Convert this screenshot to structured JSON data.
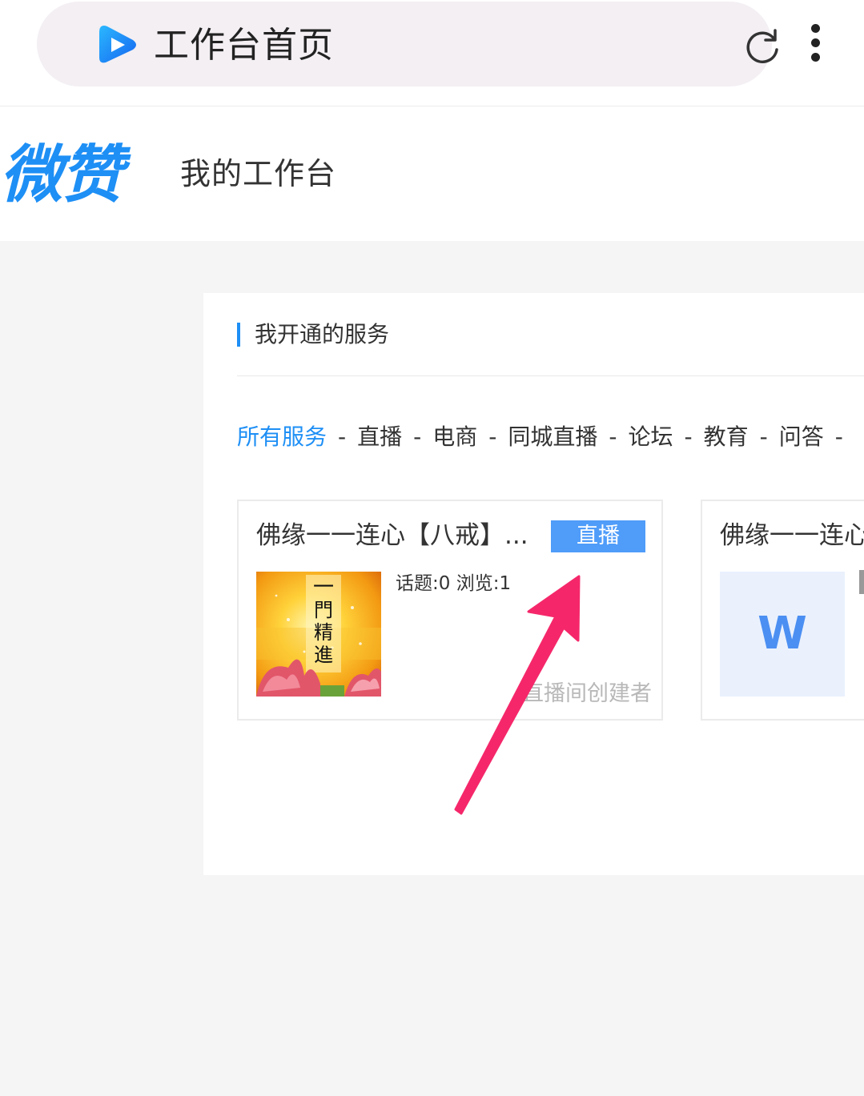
{
  "browser": {
    "title": "工作台首页",
    "icons": {
      "app": "video-play-icon",
      "reload": "reload-icon",
      "menu": "more-vertical-icon"
    }
  },
  "header": {
    "logo": "微赞",
    "title": "我的工作台"
  },
  "services": {
    "section_title": "我开通的服务",
    "filters": [
      {
        "label": "所有服务",
        "active": true
      },
      {
        "label": "直播"
      },
      {
        "label": "电商"
      },
      {
        "label": "同城直播"
      },
      {
        "label": "论坛"
      },
      {
        "label": "教育"
      },
      {
        "label": "问答"
      }
    ],
    "separator": "-",
    "cards": [
      {
        "title": "佛缘一一连心【八戒】...",
        "badge": "直播",
        "stats": "话题:0  浏览:1",
        "creator": "直播间创建者",
        "thumbnail_text": "一門精進"
      },
      {
        "title": "佛缘一一连心",
        "thumbnail_letter": "W"
      }
    ]
  },
  "colors": {
    "accent": "#1e8ff5",
    "badge": "#4f9cf9",
    "arrow": "#f5276a",
    "page_bg": "#f5f5f5"
  }
}
